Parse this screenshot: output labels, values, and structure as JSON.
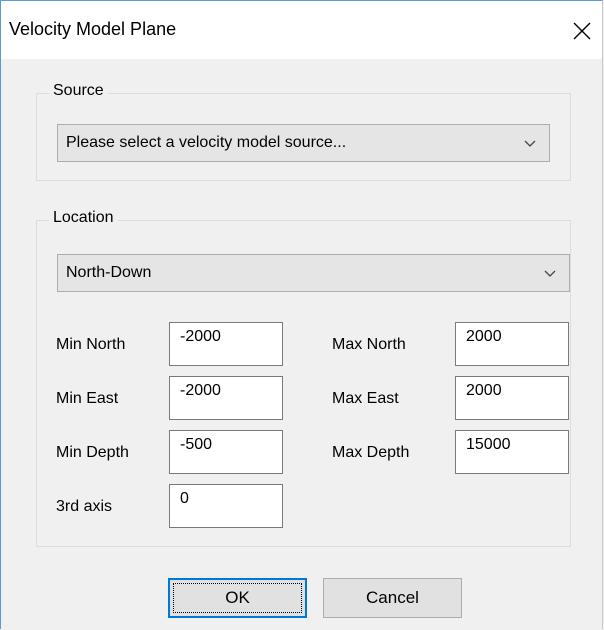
{
  "window": {
    "title": "Velocity Model Plane"
  },
  "source": {
    "group_label": "Source",
    "placeholder": "Please select a velocity model source..."
  },
  "location": {
    "group_label": "Location",
    "plane": "North-Down",
    "fields": {
      "min_north": {
        "label": "Min North",
        "value": "-2000"
      },
      "max_north": {
        "label": "Max North",
        "value": "2000"
      },
      "min_east": {
        "label": "Min East",
        "value": "-2000"
      },
      "max_east": {
        "label": "Max East",
        "value": "2000"
      },
      "min_depth": {
        "label": "Min Depth",
        "value": "-500"
      },
      "max_depth": {
        "label": "Max Depth",
        "value": "15000"
      },
      "third_axis": {
        "label": "3rd axis",
        "value": "0"
      }
    }
  },
  "buttons": {
    "ok": "OK",
    "cancel": "Cancel"
  }
}
